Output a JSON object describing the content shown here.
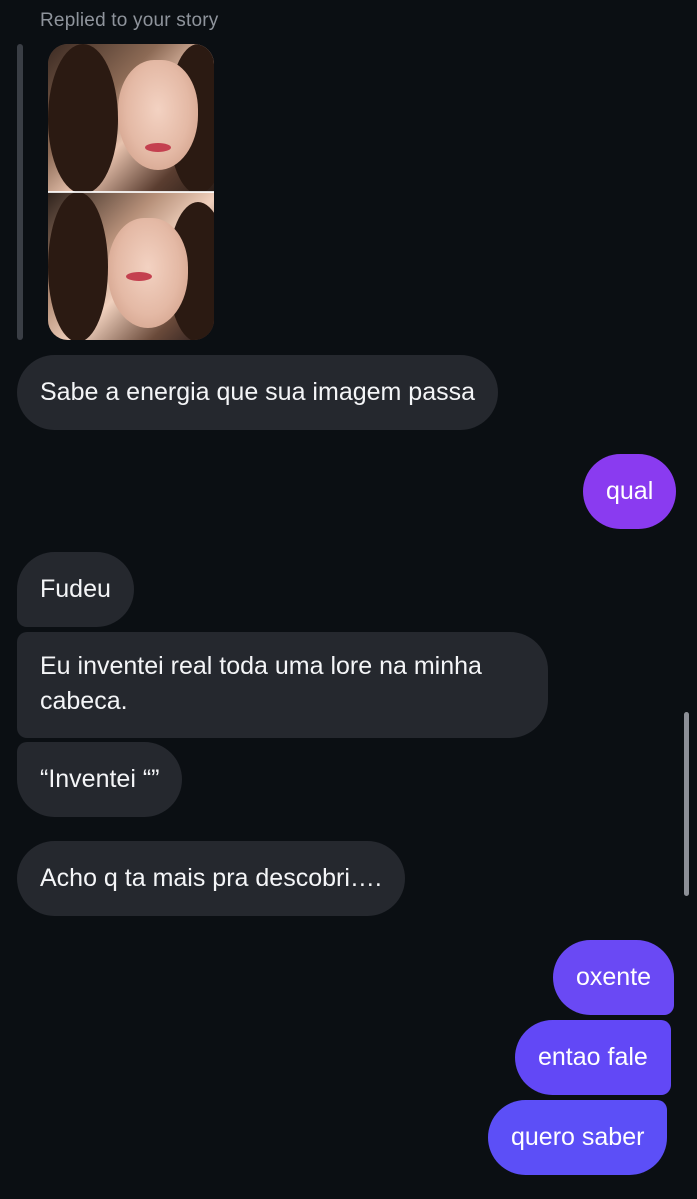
{
  "reply": {
    "label": "Replied to your story"
  },
  "messages": [
    {
      "side": "in",
      "text": "Sabe a energia que sua imagem passa"
    },
    {
      "side": "out",
      "text": "qual"
    },
    {
      "side": "in",
      "text": "Fudeu"
    },
    {
      "side": "in",
      "text": "Eu inventei real toda uma lore na minha cabeca."
    },
    {
      "side": "in",
      "text": "“Inventei “”"
    },
    {
      "side": "in",
      "text": "Acho q ta mais pra descobri…."
    },
    {
      "side": "out",
      "text": "oxente"
    },
    {
      "side": "out",
      "text": "entao fale"
    },
    {
      "side": "out",
      "text": "quero saber"
    }
  ],
  "colors": {
    "background": "#0b0f13",
    "incoming_bubble": "#25282e",
    "outgoing_gradient_start": "#8a3bf0",
    "outgoing_gradient_end": "#5b4ff7"
  }
}
